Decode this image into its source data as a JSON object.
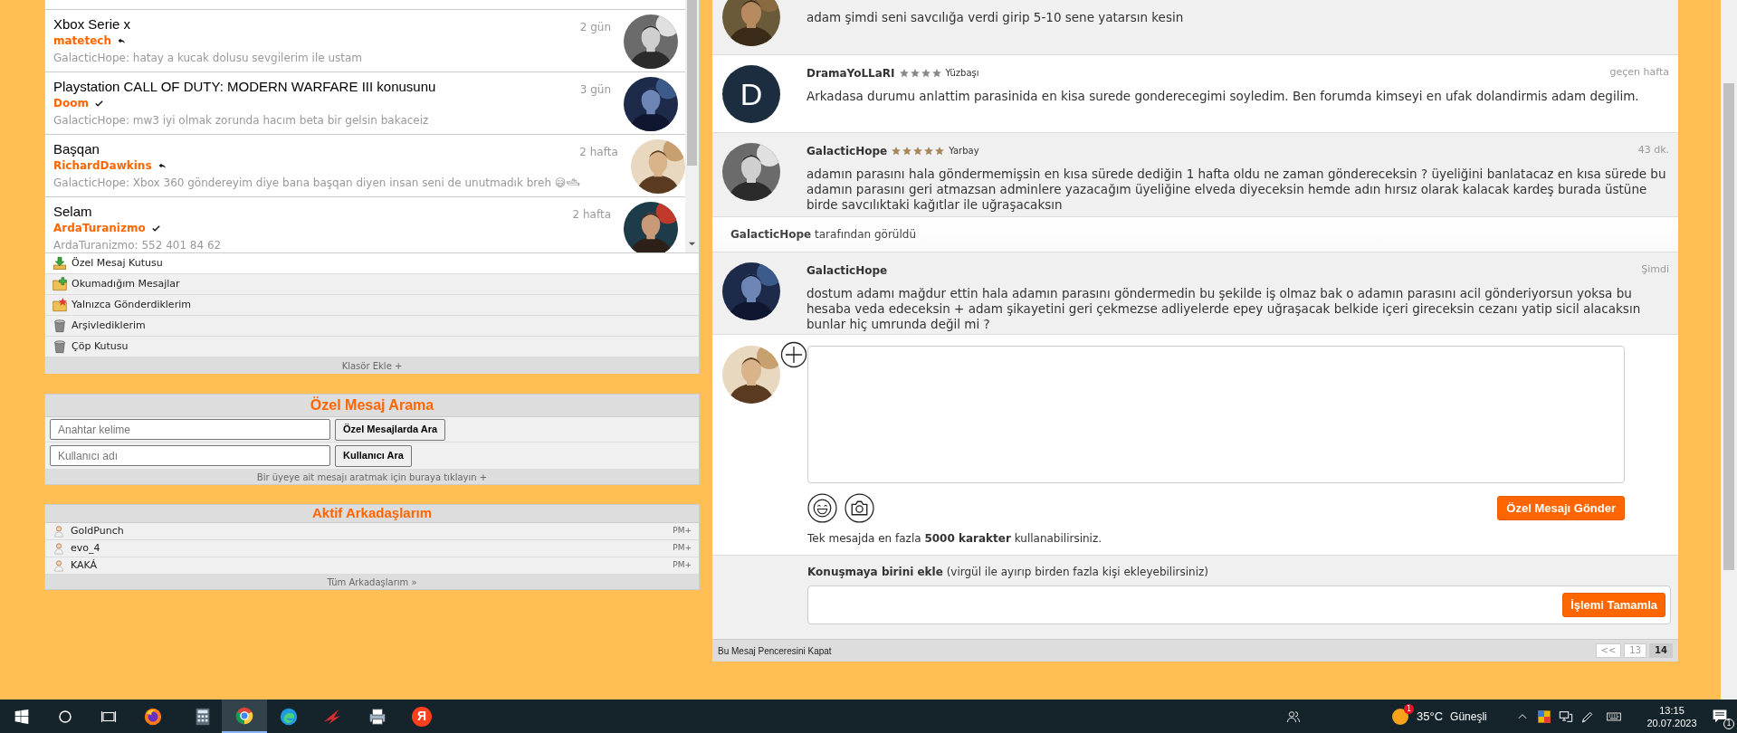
{
  "conversations": [
    {
      "title": "Xbox Serie x",
      "user": "matetech",
      "kind": "reply",
      "preview": "GalacticHope: hatay a kucak dolusu sevgilerim ile ustam",
      "time": "2 gün"
    },
    {
      "title": "Playstation CALL OF DUTY: MODERN WARFARE III konusunu",
      "user": "Doom",
      "kind": "check",
      "preview": "GalacticHope: mw3 iyi olmak zorunda hacım beta bir gelsin bakaceiz",
      "time": "3 gün"
    },
    {
      "title": "Başqan",
      "user": "RichardDawkins",
      "kind": "reply",
      "preview": "GalacticHope: Xbox 360 göndereyim diye bana başqan diyen insan seni de unutmadık breh 😅🛥",
      "time": "2 hafta"
    },
    {
      "title": "Selam",
      "user": "ArdaTuranizmo",
      "kind": "check",
      "preview": "ArdaTuranizmo: 552 401 84 62",
      "time": "2 hafta"
    }
  ],
  "folders": [
    {
      "label": "Özel Mesaj Kutusu",
      "kind": "inbox",
      "selected": true
    },
    {
      "label": "Okumadığım Mesajlar",
      "kind": "unread",
      "selected": false
    },
    {
      "label": "Yalnızca Gönderdiklerim",
      "kind": "sent",
      "selected": false
    },
    {
      "label": "Arşivlediklerim",
      "kind": "archive",
      "selected": false
    },
    {
      "label": "Çöp Kutusu",
      "kind": "trash",
      "selected": false
    }
  ],
  "folders_footer": "Klasör Ekle +",
  "search": {
    "title": "Özel Mesaj Arama",
    "keyword": {
      "placeholder": "Anahtar kelime",
      "button": "Özel Mesajlarda Ara"
    },
    "user": {
      "placeholder": "Kullanıcı adı",
      "button": "Kullanıcı Ara"
    },
    "footer": "Bir üyeye ait mesajı aratmak için buraya tıklayın +"
  },
  "friends": {
    "title": "Aktif Arkadaşlarım",
    "items": [
      {
        "name": "GoldPunch",
        "action": "PM+"
      },
      {
        "name": "evo_4",
        "action": "PM+"
      },
      {
        "name": "KAKÁ",
        "action": "PM+"
      }
    ],
    "footer": "Tüm Arkadaşlarım »"
  },
  "messages": [
    {
      "own": true,
      "text": "adam şimdi seni savcılığa verdi girip 5-10 sene yatarsın kesin"
    },
    {
      "own": false,
      "avatar": {
        "kind": "letter",
        "letter": "D"
      },
      "author": "DramaYoLLaRI",
      "stars": 4,
      "color": "#8a8a8a",
      "rank": "Yüzbaşı",
      "time": "geçen hafta",
      "text": "Arkadasa durumu anlattim parasinida en kisa surede gonderecegimi soyledim. Ben forumda kimseyi en ufak dolandirmis adam degilim."
    },
    {
      "own": true,
      "author": "GalacticHope",
      "stars": 5,
      "color": "#a6865a",
      "rank": "Yarbay",
      "time": "43 dk.",
      "text": "adamın parasını hala göndermemişsin en kısa sürede dediğin 1 hafta oldu ne zaman göndereceksin ? üyeliğini banlatacaz en kısa sürede bu adamın parasını geri atmazsan adminlere yazacağım üyeliğine elveda diyeceksin hemde adın hırsız olarak kalacak kardeş burada üstüne birde savcılıktaki kağıtlar ile uğraşacaksın"
    }
  ],
  "seen": "**GalacticHope** tarafından görüldü",
  "last_message": {
    "own": true,
    "author": "GalacticHope",
    "time": "Şimdi",
    "text": "dostum adamı mağdur ettin hala adamın parasını göndermedin bu şekilde iş olmaz bak o adamın parasını acil gönderiyorsun yoksa bu hesaba veda edeceksin + adam şikayetini geri çekmezse adliyelerde epey uğraşacak belkide içeri gireceksin cezanı yatip sicil alacaksın bunlar hiç umrunda değil mi ?"
  },
  "composer": {
    "send_button": "Özel Mesajı Gönder",
    "note": "Tek mesajda en fazla **5000 karakter** kullanabilirsiniz."
  },
  "add_person": {
    "label": "**Konuşmaya birini ekle** (virgül ile ayırıp birden fazla kişi ekleyebilirsiniz)",
    "button": "İşlemi Tamamla"
  },
  "footer": {
    "close_link": "Bu Mesaj Penceresini Kapat",
    "pages": [
      {
        "label": "<<",
        "selected": false
      },
      {
        "label": "13",
        "selected": false
      },
      {
        "label": "14",
        "selected": true
      }
    ]
  },
  "taskbar": {
    "app_letter": "Я",
    "weather_badge": "1",
    "temperature": "35°C",
    "weather": "Güneşli",
    "time": "13:15",
    "date": "20.07.2023",
    "notifications": "1"
  }
}
